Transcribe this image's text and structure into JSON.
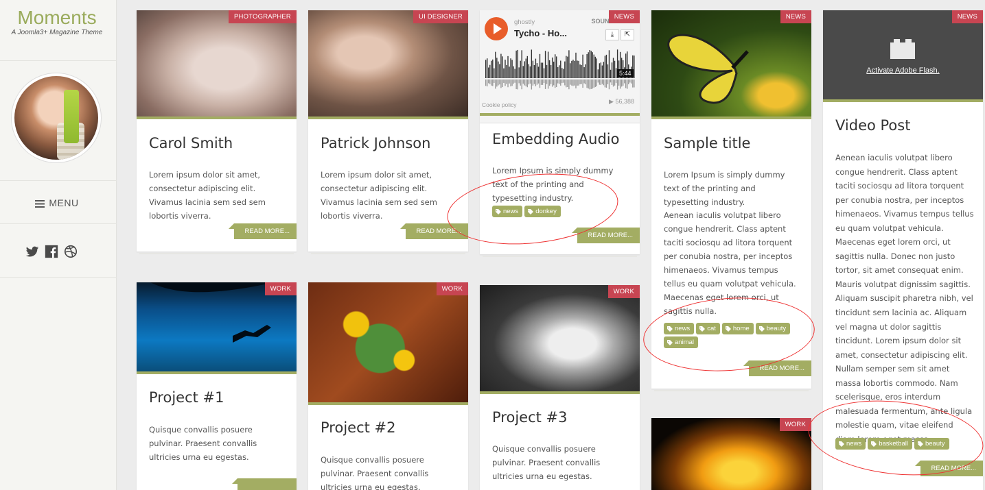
{
  "brand": {
    "title": "Moments",
    "tagline": "A Joomla3+ Magazine Theme"
  },
  "sidebar": {
    "menu_label": "MENU",
    "social": [
      "twitter-icon",
      "facebook-icon",
      "dribbble-icon"
    ]
  },
  "readmore_label": "READ MORE...",
  "cards": {
    "carol": {
      "badge": "PHOTOGRAPHER",
      "title": "Carol Smith",
      "body": "Lorem ipsum dolor sit amet, consectetur adipiscing elit. Vivamus lacinia sem sed sem lobortis viverra."
    },
    "patrick": {
      "badge": "UI DESIGNER",
      "title": "Patrick Johnson",
      "body": "Lorem ipsum dolor sit amet, consectetur adipiscing elit. Vivamus lacinia sem sed sem lobortis viverra."
    },
    "audio": {
      "badge": "NEWS",
      "title": "Embedding Audio",
      "body": "Lorem Ipsum is simply dummy text of the printing and typesetting industry.",
      "tags": [
        "news",
        "donkey"
      ],
      "player": {
        "artist": "ghostly",
        "track": "Tycho - Ho...",
        "brand": "SOUNDCLOUD",
        "duration": "5:44",
        "cookie": "Cookie policy",
        "plays": "▶ 56,388"
      }
    },
    "sample": {
      "badge": "NEWS",
      "title": "Sample title",
      "body1": "Lorem Ipsum is simply dummy text of the printing and typesetting industry.",
      "body2": "Aenean iaculis volutpat libero congue hendrerit. Class aptent taciti sociosqu ad litora torquent per conubia nostra, per inceptos himenaeos. Vivamus tempus tellus eu quam volutpat vehicula. Maecenas eget lorem orci, ut sagittis nulla.",
      "tags": [
        "news",
        "cat",
        "home",
        "beauty",
        "animal"
      ]
    },
    "video": {
      "badge": "NEWS",
      "title": "Video Post",
      "flash_link": "Activate Adobe Flash.",
      "body": "Aenean iaculis volutpat libero congue hendrerit. Class aptent taciti sociosqu ad litora torquent per conubia nostra, per inceptos himenaeos. Vivamus tempus tellus eu quam volutpat vehicula. Maecenas eget lorem orci, ut sagittis nulla. Donec non justo tortor, sit amet consequat enim. Mauris volutpat dignissim sagittis. Aliquam suscipit pharetra nibh, vel tincidunt sem lacinia ac. Aliquam vel magna ut dolor sagittis tincidunt. Lorem ipsum dolor sit amet, consectetur adipiscing elit. Nullam semper sem sit amet massa lobortis commodo. Nam scelerisque, eros interdum malesuada fermentum, ante ligula molestie quam, vitae eleifend diam lorem eget massa.",
      "tags": [
        "news",
        "basketball",
        "beauty"
      ]
    },
    "p1": {
      "badge": "WORK",
      "title": "Project #1",
      "body": "Quisque convallis posuere pulvinar. Praesent convallis ultricies urna eu egestas."
    },
    "p2": {
      "badge": "WORK",
      "title": "Project #2",
      "body": "Quisque convallis posuere pulvinar. Praesent convallis ultricies urna eu egestas."
    },
    "p3": {
      "badge": "WORK",
      "title": "Project #3",
      "body": "Quisque convallis posuere pulvinar. Praesent convallis ultricies urna eu egestas."
    },
    "flower": {
      "badge": "WORK"
    }
  },
  "colors": {
    "accent": "#a3ad63",
    "badge": "#c74552",
    "brand": "#9aab5c",
    "annotation": "#e33333"
  }
}
